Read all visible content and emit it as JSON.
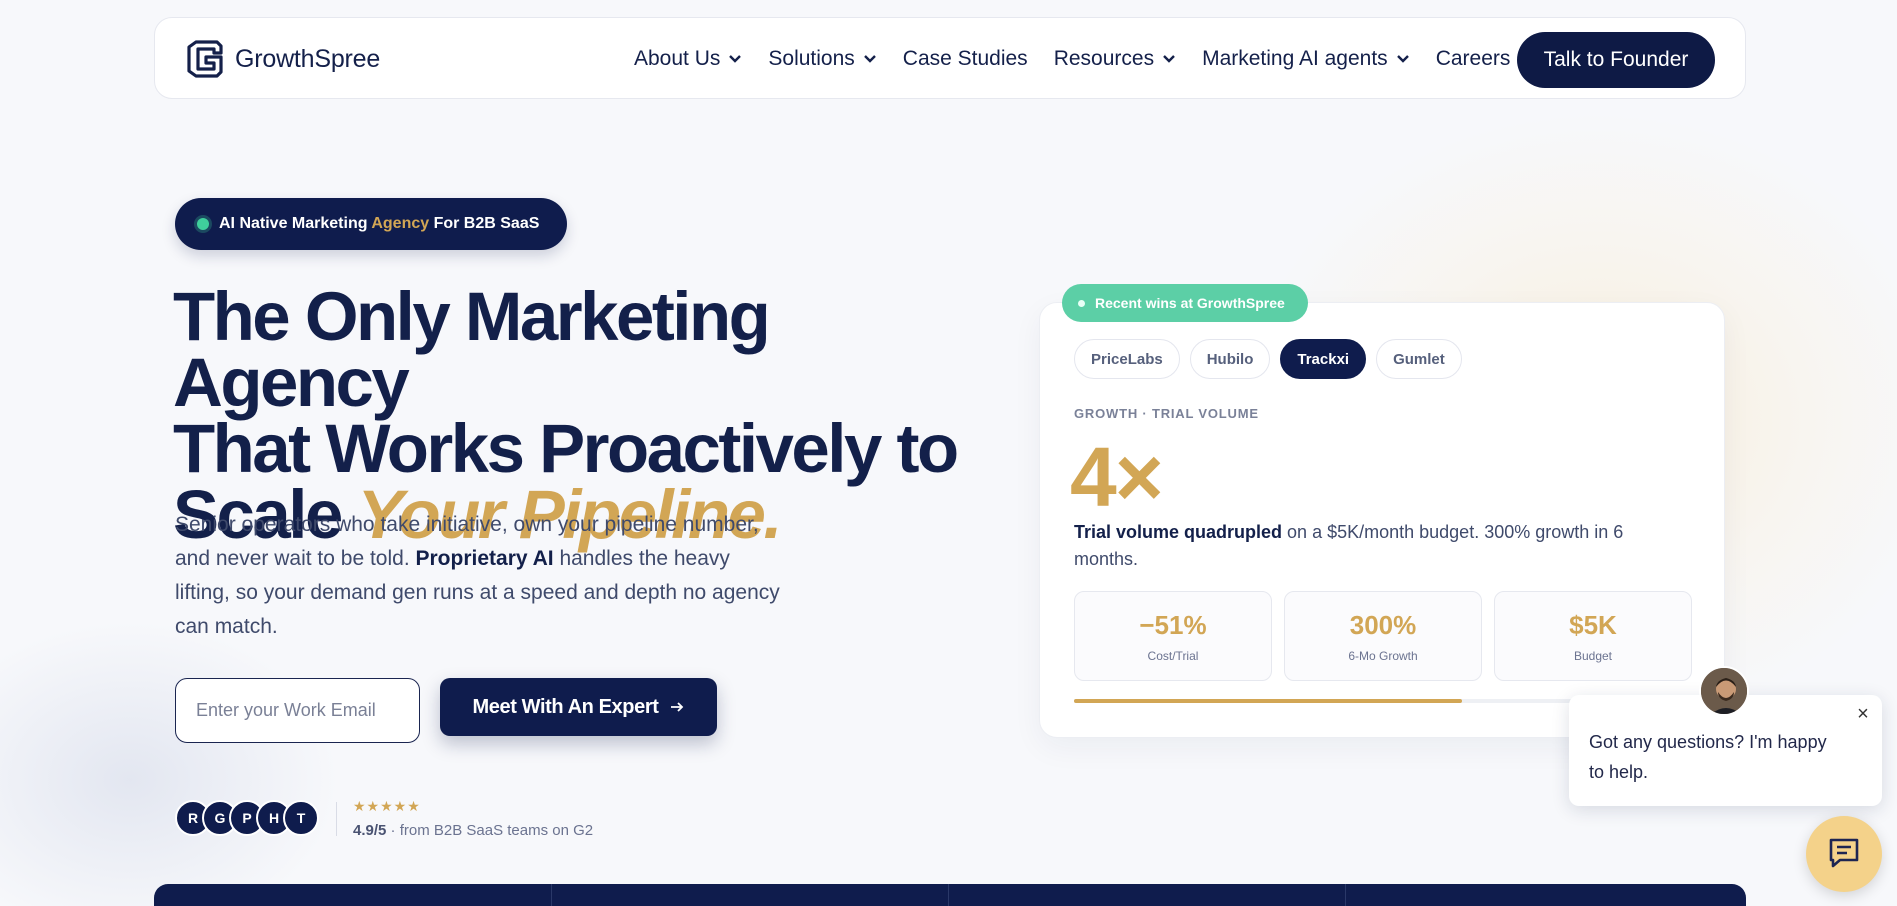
{
  "brand": {
    "name": "GrowthSpree"
  },
  "nav": {
    "items": [
      {
        "label": "About Us",
        "has_dropdown": true
      },
      {
        "label": "Solutions",
        "has_dropdown": true
      },
      {
        "label": "Case Studies",
        "has_dropdown": false
      },
      {
        "label": "Resources",
        "has_dropdown": true
      },
      {
        "label": "Marketing AI agents",
        "has_dropdown": true
      },
      {
        "label": "Careers",
        "has_dropdown": false
      }
    ],
    "cta": "Talk to Founder"
  },
  "hero": {
    "badge": {
      "pre": "AI Native Marketing ",
      "accent": "Agency",
      "post": " For B2B SaaS"
    },
    "headline": {
      "line1": "The Only Marketing Agency",
      "line2": "That Works Proactively to",
      "line3_pre": "Scale ",
      "line3_accent": "Your Pipeline."
    },
    "subtext": {
      "part1": "Senior operators who take initiative, own your pipeline number, and never wait to be told. ",
      "bold": "Proprietary AI",
      "part2": " handles the heavy lifting, so your demand gen runs at a speed and depth no agency can match."
    },
    "email_placeholder": "Enter your Work Email",
    "cta": "Meet With An Expert",
    "avatars": [
      "R",
      "G",
      "P",
      "H",
      "T"
    ],
    "stars": "★★★★★",
    "rating_value": "4.9/5",
    "rating_text": " · from B2B SaaS teams on G2"
  },
  "wins": {
    "pill": "Recent wins at GrowthSpree",
    "tabs": [
      {
        "label": "PriceLabs",
        "active": false
      },
      {
        "label": "Hubilo",
        "active": false
      },
      {
        "label": "Trackxi",
        "active": true
      },
      {
        "label": "Gumlet",
        "active": false
      }
    ],
    "metric_label": "GROWTH · TRIAL VOLUME",
    "big_metric": "4×",
    "desc_bold": "Trial volume quadrupled",
    "desc_rest": " on a $5K/month budget. 300% growth in 6 months.",
    "stats": [
      {
        "value": "−51%",
        "label": "Cost/Trial"
      },
      {
        "value": "300%",
        "label": "6-Mo Growth"
      },
      {
        "value": "$5K",
        "label": "Budget"
      }
    ],
    "progress": 0.63
  },
  "chat": {
    "message": "Got any questions? I'm happy to help.",
    "close": "×"
  },
  "colors": {
    "navy": "#0f1c4d",
    "gold": "#d2a655",
    "mint": "#5ccfa6"
  }
}
